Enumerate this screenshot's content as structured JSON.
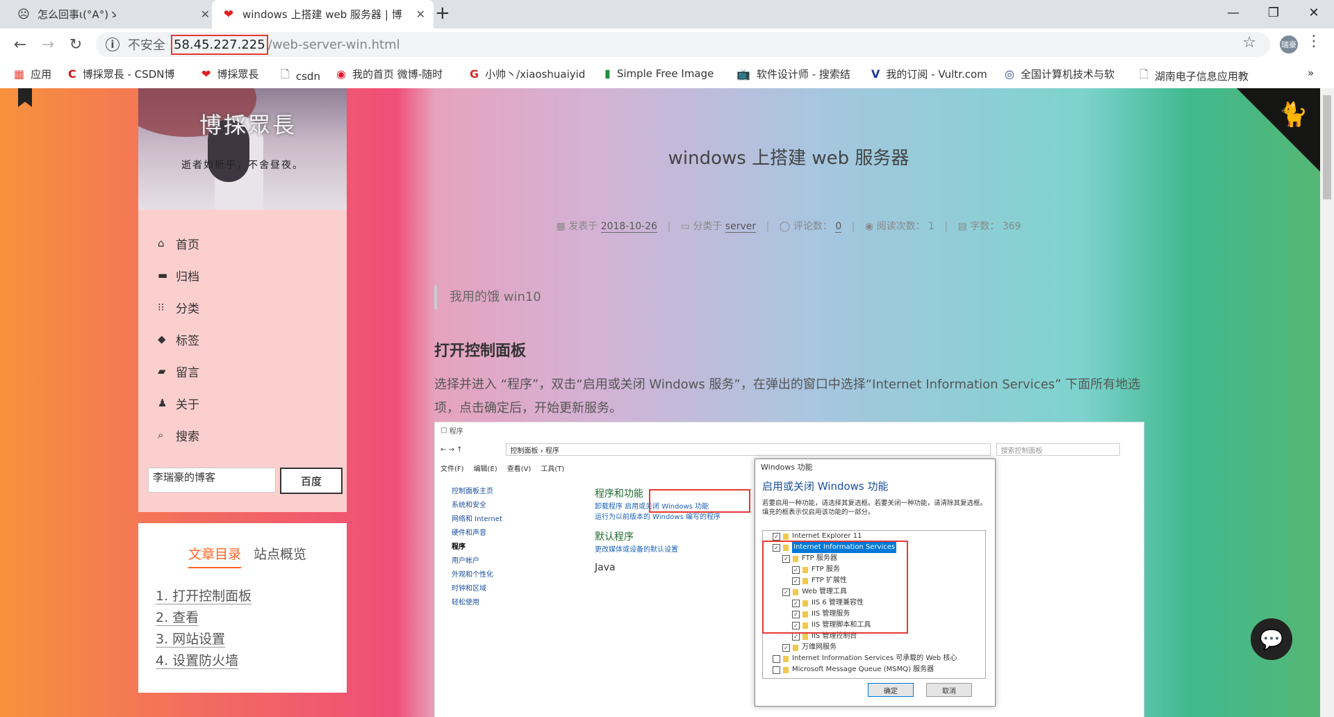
{
  "browser": {
    "tabs": [
      {
        "title": "怎么回事ι(°A°)ゝ",
        "icon": "face-icon"
      },
      {
        "title": "windows 上搭建 web 服务器 | 博",
        "icon": "heart-icon"
      }
    ],
    "address": {
      "security": "不安全",
      "host": "58.45.227.225",
      "path": "/web-server-win.html"
    },
    "profile_initials": "瑞豪",
    "bookmarks": [
      {
        "label": "应用",
        "icon": "apps-icon"
      },
      {
        "label": "博採眾長 - CSDN博",
        "icon": "csdn-icon"
      },
      {
        "label": "博採眾長",
        "icon": "heart-icon"
      },
      {
        "label": "csdn",
        "icon": "page-icon"
      },
      {
        "label": "我的首页 微博-随时",
        "icon": "weibo-icon"
      },
      {
        "label": "小帅丶/xiaoshuaiyid",
        "icon": "g-icon"
      },
      {
        "label": "Simple Free Image",
        "icon": "bars-icon"
      },
      {
        "label": "软件设计师 - 搜索结",
        "icon": "tv-icon"
      },
      {
        "label": "我的订阅 - Vultr.com",
        "icon": "v-icon"
      },
      {
        "label": "全国计算机技术与软",
        "icon": "globe-icon"
      },
      {
        "label": "湖南电子信息应用教",
        "icon": "page-icon"
      }
    ]
  },
  "sidebar": {
    "site_title": "博採眾長",
    "motto": "逝者如斯乎，不舍昼夜。",
    "menu": [
      {
        "label": "首页",
        "icon": "home-icon"
      },
      {
        "label": "归档",
        "icon": "archive-icon"
      },
      {
        "label": "分类",
        "icon": "grid-icon"
      },
      {
        "label": "标签",
        "icon": "tags-icon"
      },
      {
        "label": "留言",
        "icon": "book-icon"
      },
      {
        "label": "关于",
        "icon": "user-icon"
      },
      {
        "label": "搜索",
        "icon": "search-icon"
      }
    ],
    "search_value": "李瑞豪的博客",
    "search_button": "百度",
    "toc_tabs": [
      "文章目录",
      "站点概览"
    ],
    "toc": [
      "1. 打开控制面板",
      "2. 查看",
      "3. 网站设置",
      "4. 设置防火墙"
    ]
  },
  "post": {
    "title": "windows 上搭建 web 服务器",
    "meta": {
      "posted_label": "发表于",
      "date": "2018-10-26",
      "category_label": "分类于",
      "category": "server",
      "comments_label": "评论数：",
      "comments": "0",
      "views_label": "阅读次数：",
      "views": "1",
      "words_label": "字数：",
      "words": "369"
    },
    "quote": "我用的饿 win10",
    "heading": "打开控制面板",
    "paragraph": "选择并进入 “程序”，双击“启用或关闭 Windows 服务”，在弹出的窗口中选择“Internet Information Services” 下面所有地选项，点击确定后，开始更新服务。"
  },
  "screenshot": {
    "window_title": "程序",
    "breadcrumb": "控制面板 › 程序",
    "search_placeholder": "搜索控制面板",
    "menubar": [
      "文件(F)",
      "编辑(E)",
      "查看(V)",
      "工具(T)"
    ],
    "left_nav": [
      "控制面板主页",
      "系统和安全",
      "网络和 Internet",
      "硬件和声音",
      "程序",
      "用户帐户",
      "外观和个性化",
      "时钟和区域",
      "轻松使用"
    ],
    "programs_heading": "程序和功能",
    "programs_links": "卸载程序   启用或关闭 Windows 功能",
    "programs_sub": "运行为以前版本的 Windows 编写的程序",
    "default_heading": "默认程序",
    "default_link": "更改媒体或设备的默认设置",
    "java": "Java",
    "dialog": {
      "title": "Windows 功能",
      "heading": "启用或关闭 Windows 功能",
      "desc": "若要启用一种功能，请选择其复选框。若要关闭一种功能，请清除其复选框。填充的框表示仅启用该功能的一部分。",
      "tree": [
        "Internet Explorer 11",
        "Internet Information Services",
        "FTP 服务器",
        "FTP 服务",
        "FTP 扩展性",
        "Web 管理工具",
        "IIS 6 管理兼容性",
        "IIS 管理服务",
        "IIS 管理脚本和工具",
        "IIS 管理控制台",
        "万维网服务",
        "Internet Information Services 可承载的 Web 核心",
        "Microsoft Message Queue (MSMQ) 服务器"
      ],
      "ok": "确定",
      "cancel": "取消"
    }
  }
}
